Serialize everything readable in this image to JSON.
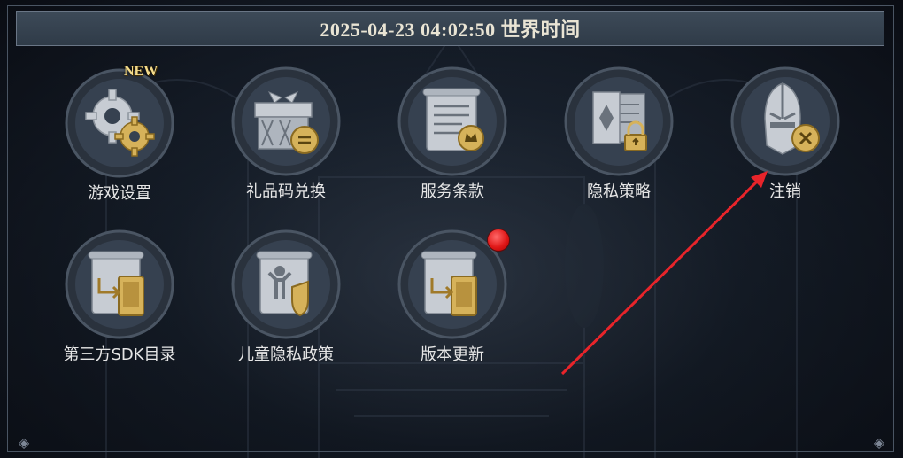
{
  "title_bar": {
    "text": "2025-04-23 04:02:50 世界时间"
  },
  "menu": {
    "items": [
      {
        "label": "游戏设置",
        "icon": "gear-icon",
        "badge": "NEW"
      },
      {
        "label": "礼品码兑换",
        "icon": "gift-icon"
      },
      {
        "label": "服务条款",
        "icon": "scroll-icon"
      },
      {
        "label": "隐私策略",
        "icon": "privacy-lock-icon"
      },
      {
        "label": "注销",
        "icon": "helmet-cancel-icon"
      },
      {
        "label": "第三方SDK目录",
        "icon": "sdk-list-icon"
      },
      {
        "label": "儿童隐私政策",
        "icon": "child-shield-icon"
      },
      {
        "label": "版本更新",
        "icon": "update-icon",
        "notification": true
      }
    ]
  },
  "colors": {
    "title_bg": "#34404d",
    "label_text": "#e6e6e6",
    "badge_gold": "#f4dc8c",
    "arrow_red": "#e8242a",
    "notification_red": "#e01818"
  }
}
